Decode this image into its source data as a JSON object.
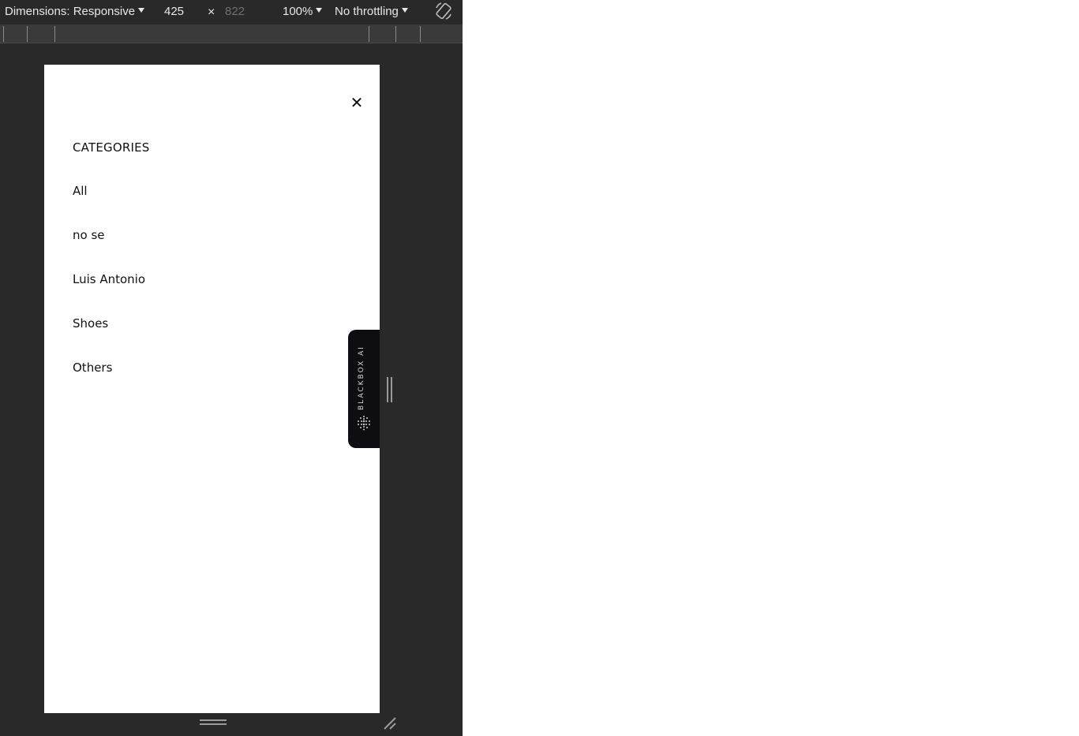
{
  "devtools": {
    "dimensions_label": "Dimensions: Responsive",
    "width_value": "425",
    "times_symbol": "×",
    "height_value": "822",
    "zoom_label": "100%",
    "throttling_label": "No throttling"
  },
  "menu": {
    "close_symbol": "✕",
    "heading": "CATEGORIES",
    "categories": [
      "All",
      "no se",
      "Luis Antonio",
      "Shoes",
      "Others"
    ]
  },
  "blackbox": {
    "label": "BLACKBOX AI"
  },
  "colors": {
    "devtools_bg": "#292929",
    "viewport_bg": "#ffffff",
    "blackbox_bg": "#0d0d12"
  }
}
